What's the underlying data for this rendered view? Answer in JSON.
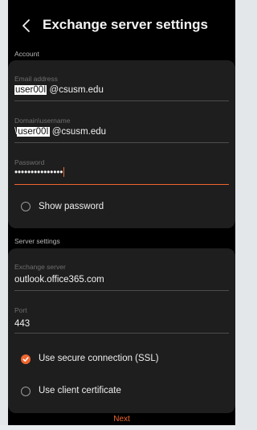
{
  "header": {
    "title": "Exchange server settings"
  },
  "account": {
    "section_label": "Account",
    "email": {
      "label": "Email address",
      "value_redacted": "user00I",
      "value_suffix": " @csusm.edu"
    },
    "domain_username": {
      "label": "Domain\\username",
      "value_prefix": "\\",
      "value_redacted": "user00I",
      "value_suffix": " @csusm.edu"
    },
    "password": {
      "label": "Password",
      "value": "•••••••••••••••"
    },
    "show_password": {
      "label": "Show password",
      "checked": false
    }
  },
  "server": {
    "section_label": "Server settings",
    "exchange_server": {
      "label": "Exchange server",
      "value": "outlook.office365.com"
    },
    "port": {
      "label": "Port",
      "value": "443"
    },
    "ssl": {
      "label": "Use secure connection (SSL)",
      "checked": true
    },
    "client_cert": {
      "label": "Use client certificate",
      "checked": false
    }
  },
  "footer": {
    "next_label": "Next"
  },
  "colors": {
    "accent": "#f0662f",
    "card": "#1e1e1e",
    "background": "#000000"
  },
  "icons": {
    "back": "chevron-left-icon",
    "check": "check-icon"
  }
}
